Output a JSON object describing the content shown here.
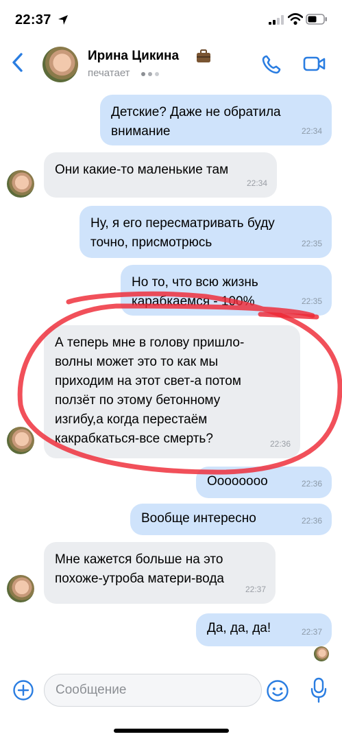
{
  "status_bar": {
    "time": "22:37"
  },
  "header": {
    "contact_name": "Ирина Цикина",
    "status": "печатает"
  },
  "messages": [
    {
      "direction": "out",
      "text": "Детские? Даже не обратила\nвнимание",
      "time": "22:34"
    },
    {
      "direction": "in",
      "text": "Они какие-то маленькие там",
      "time": "22:34"
    },
    {
      "direction": "out",
      "text": "Ну, я его пересматривать буду\nточно, присмотрюсь",
      "time": "22:35"
    },
    {
      "direction": "out",
      "text": "Но то, что всю жизнь\nкарабкаемся - 100%",
      "time": "22:35"
    },
    {
      "direction": "in",
      "text": "А теперь мне в голову пришло-\nволны может это то как мы\nприходим на этот свет-а потом\nползёт по этому бетонному\nизгибу,а когда перестаём\nкакрабкаться-все смерть?",
      "time": "22:36"
    },
    {
      "direction": "out",
      "text": "Оооооооо",
      "time": "22:36"
    },
    {
      "direction": "out",
      "text": "Вообще интересно",
      "time": "22:36"
    },
    {
      "direction": "in",
      "text": "Мне кажется больше на это\nпохоже-утроба матери-вода",
      "time": "22:37"
    },
    {
      "direction": "out",
      "text": "Да, да, да!",
      "time": "22:37"
    }
  ],
  "input": {
    "placeholder": "Сообщение"
  },
  "colors": {
    "accent": "#2a7de1",
    "outgoing_bubble": "#cfe3fb",
    "incoming_bubble": "#ebedf0",
    "annotation": "#ee2a36"
  },
  "icons": {
    "back": "chevron-left-icon",
    "call": "phone-icon",
    "video": "video-camera-icon",
    "attach": "plus-circle-icon",
    "emoji": "smiley-icon",
    "voice": "microphone-icon"
  }
}
